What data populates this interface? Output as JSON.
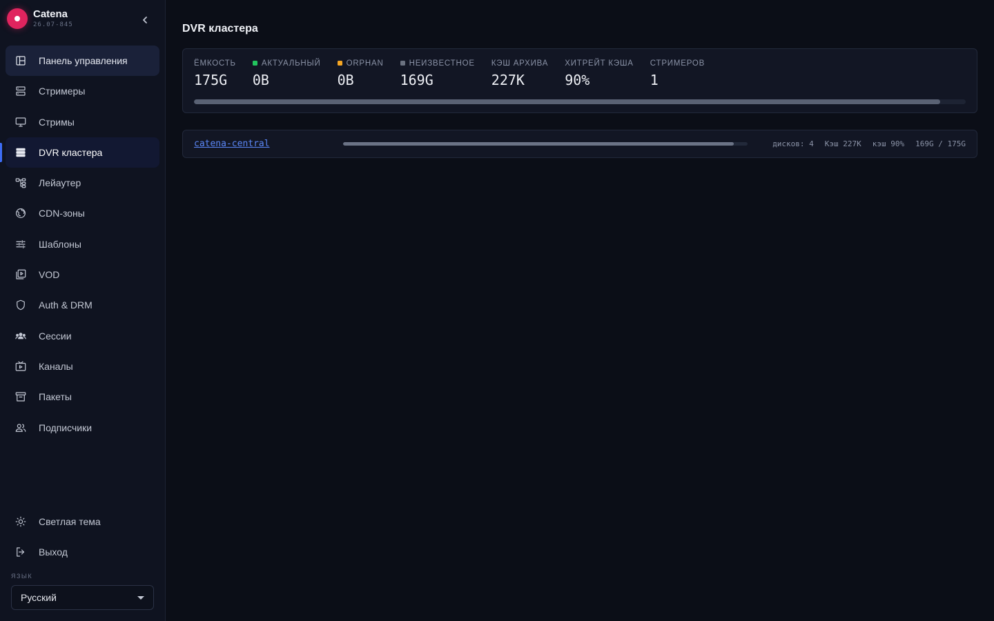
{
  "brand": {
    "name": "Catena",
    "version": "26.07-845",
    "accent": "#e0245e",
    "logo_icon": "record-dot-icon",
    "collapse_icon": "chevron-left-icon"
  },
  "sidebar": {
    "items": [
      {
        "label": "Панель управления",
        "icon": "dashboard-icon"
      },
      {
        "label": "Стримеры",
        "icon": "server-icon"
      },
      {
        "label": "Стримы",
        "icon": "monitor-icon"
      },
      {
        "label": "DVR кластера",
        "icon": "storage-list-icon"
      },
      {
        "label": "Лейаутер",
        "icon": "layout-tree-icon"
      },
      {
        "label": "CDN-зоны",
        "icon": "globe-icon"
      },
      {
        "label": "Шаблоны",
        "icon": "sliders-icon"
      },
      {
        "label": "VOD",
        "icon": "video-library-icon"
      },
      {
        "label": "Auth & DRM",
        "icon": "shield-icon"
      },
      {
        "label": "Сессии",
        "icon": "users-group-icon"
      },
      {
        "label": "Каналы",
        "icon": "tv-icon"
      },
      {
        "label": "Пакеты",
        "icon": "archive-box-icon"
      },
      {
        "label": "Подписчики",
        "icon": "subscribers-icon"
      }
    ],
    "active_index": 3,
    "hover_index": 0,
    "theme_toggle": {
      "label": "Светлая тема",
      "icon": "sun-icon"
    },
    "logout": {
      "label": "Выход",
      "icon": "logout-icon"
    },
    "language": {
      "label": "ЯЗЫК",
      "value": "Русский"
    }
  },
  "page": {
    "title": "DVR кластера"
  },
  "summary": {
    "stats": [
      {
        "label": "ЁМКОСТЬ",
        "value": "175G",
        "dot": null
      },
      {
        "label": "АКТУАЛЬНЫЙ",
        "value": "0B",
        "dot": "#22c55e"
      },
      {
        "label": "ORPHAN",
        "value": "0B",
        "dot": "#f5a623"
      },
      {
        "label": "НЕИЗВЕСТНОЕ",
        "value": "169G",
        "dot": "#6b7280"
      },
      {
        "label": "КЭШ АРХИВА",
        "value": "227K",
        "dot": null
      },
      {
        "label": "ХИТРЕЙТ КЭША",
        "value": "90%",
        "dot": null
      },
      {
        "label": "СТРИМЕРОВ",
        "value": "1",
        "dot": null
      }
    ],
    "usage_fraction": 0.967
  },
  "clusters": [
    {
      "name": "catena-central",
      "usage_fraction": 0.966,
      "disks": "дисков: 4",
      "cache": "Кэш 227K",
      "hitrate": "кэш 90%",
      "usage": "169G / 175G"
    }
  ]
}
